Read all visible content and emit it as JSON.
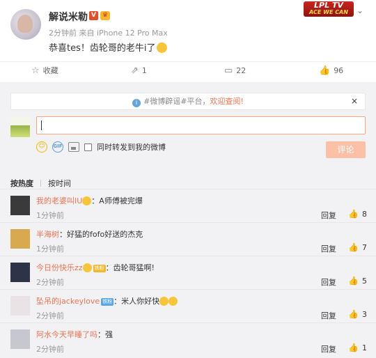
{
  "post": {
    "author": "解说米勒",
    "verified_badge": "V",
    "badge_glyph": "♛",
    "meta": "2分钟前 来自 iPhone 12 Pro Max",
    "text": "恭喜tes！齿轮哥的老牛i了",
    "emoji_icon": "smile-emoji",
    "brand_logo_top": "LPL TV",
    "brand_logo_bottom": "ACE WE CAN",
    "chevron_glyph": "⌄"
  },
  "actions": {
    "favorite_label": "收藏",
    "repost_count": "1",
    "comment_count": "22",
    "like_count": "96",
    "icons": {
      "favorite": "☆",
      "repost": "⇗",
      "comment": "▭",
      "like": "👍"
    }
  },
  "comment_panel": {
    "notice_prefix": "#微博辟谣#平台，",
    "notice_link": "欢迎查阅!",
    "notice_info_glyph": "i",
    "notice_close_glyph": "×",
    "repost_option_label": "同时转发到我的微博",
    "submit_label": "评论",
    "tool_icons": {
      "emoji": "☺",
      "gif": "GIF"
    },
    "sort_hot": "按热度",
    "sort_time": "按时间",
    "reply_label": "回复",
    "comments": [
      {
        "user": "我的老婆叫IU",
        "text": "：A师傅被完爆",
        "time": "1分钟前",
        "likes": "8",
        "badge": "",
        "avatar_color": "#3a3a3a"
      },
      {
        "user": "半海树",
        "text": "：好猛的fofo好送的杰克",
        "time": "1分钟前",
        "likes": "7",
        "badge": "",
        "avatar_color": "#d8a94e"
      },
      {
        "user": "今日份快乐zz",
        "text": "：齿轮哥猛啊!",
        "time": "2分钟前",
        "likes": "5",
        "badge": "铁粉",
        "avatar_color": "#2e3448"
      },
      {
        "user": "坠吊的jackeylove",
        "text": "：米人你好快",
        "time": "2分钟前",
        "likes": "3",
        "badge": "铁粉",
        "avatar_color": "#e9e3e6"
      },
      {
        "user": "阿水今天早睡了吗",
        "text": "：强",
        "time": "2分钟前",
        "likes": "1",
        "badge": "",
        "avatar_color": "#c7c7cf"
      }
    ]
  }
}
